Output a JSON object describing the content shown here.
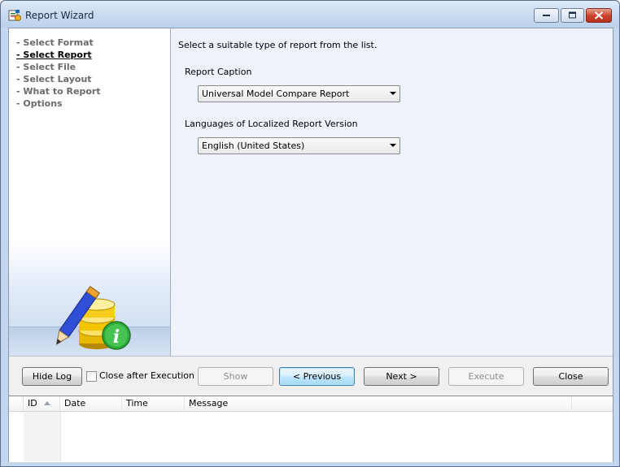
{
  "window": {
    "title": "Report Wizard",
    "accent": "#c4d7ee"
  },
  "nav": {
    "items": [
      {
        "label": "- Select Format"
      },
      {
        "label": "- Select Report"
      },
      {
        "label": "- Select File"
      },
      {
        "label": "- Select Layout"
      },
      {
        "label": "- What to Report"
      },
      {
        "label": "- Options"
      }
    ],
    "active_index": 1
  },
  "main": {
    "instruction": "Select a suitable type of report from the list.",
    "report_caption_label": "Report Caption",
    "report_caption_value": "Universal Model Compare Report",
    "language_label": "Languages of Localized Report Version",
    "language_value": "English (United States)"
  },
  "footer": {
    "hide_log_label": "Hide Log",
    "close_after_execution_label": "Close after Execution",
    "close_after_execution_checked": false,
    "show_label": "Show",
    "previous_label": "< Previous",
    "next_label": "Next >",
    "execute_label": "Execute",
    "close_label": "Close"
  },
  "log": {
    "columns": [
      "ID",
      "Date",
      "Time",
      "Message"
    ],
    "rows": []
  },
  "icons": {
    "app": "report-wizard-icon",
    "graphic": "pencil-database-info-icon"
  }
}
